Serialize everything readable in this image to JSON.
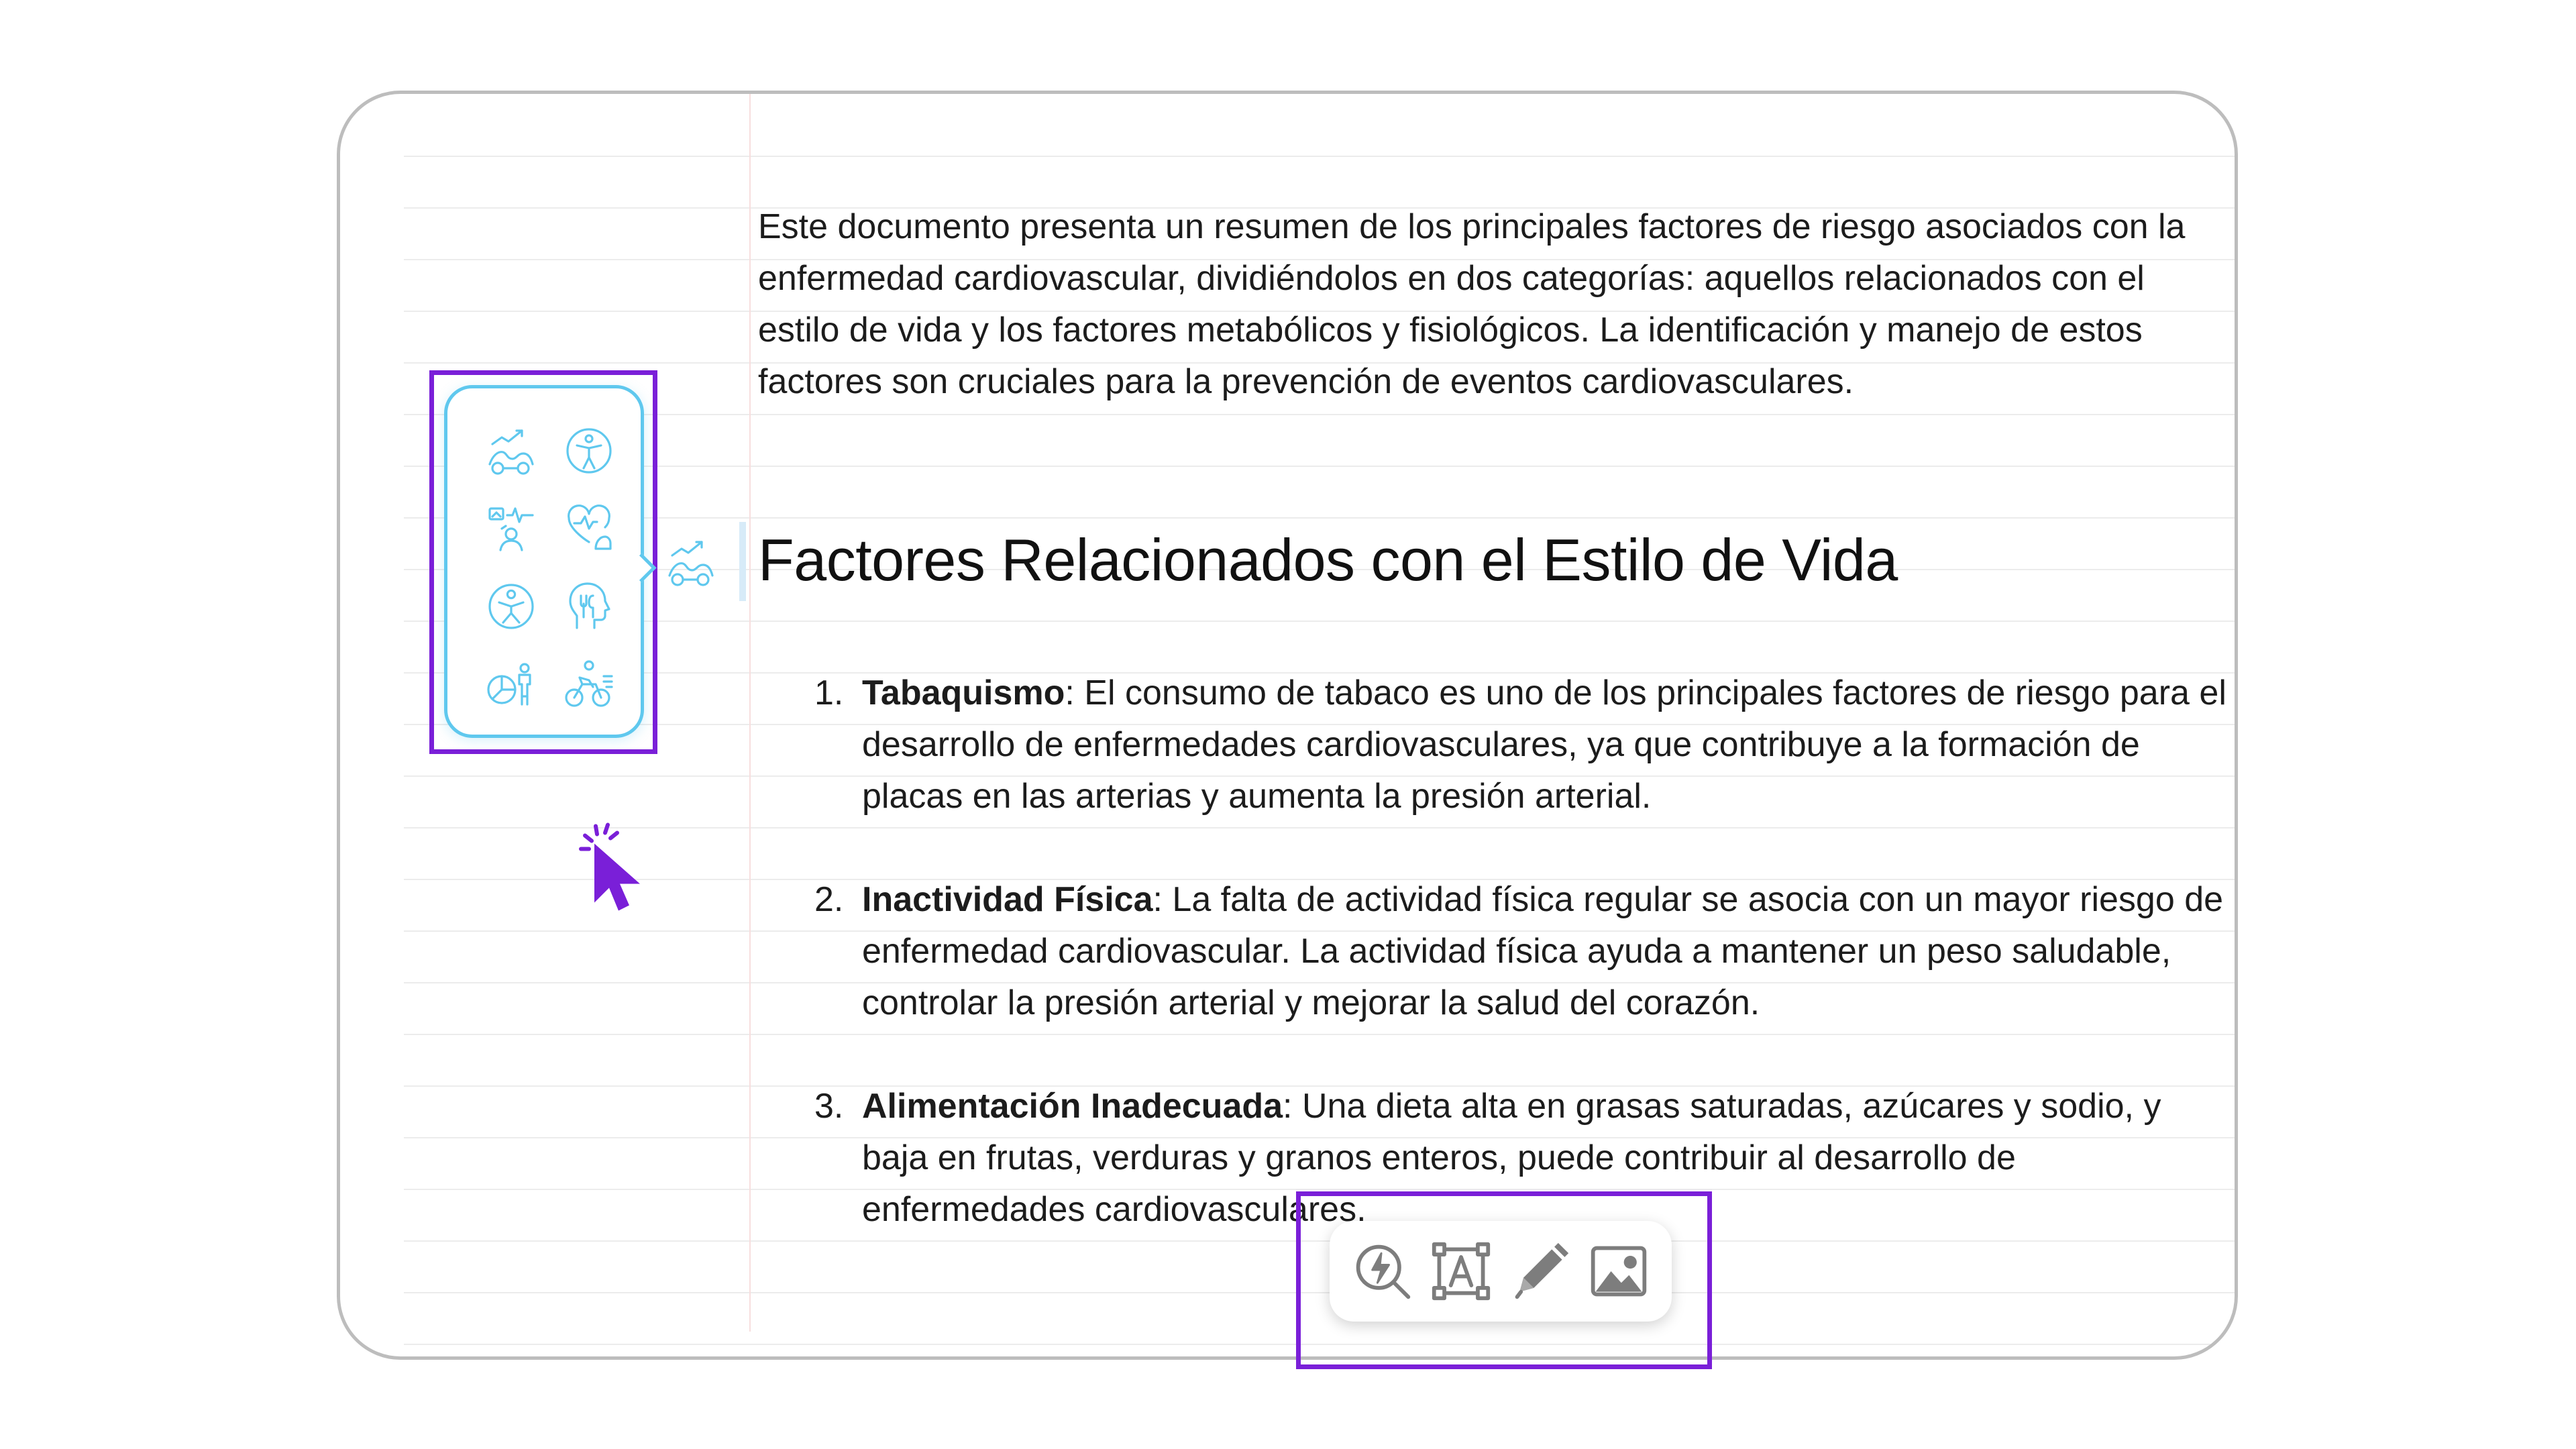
{
  "colors": {
    "highlight": "#7a1fd8",
    "icon_accent": "#5fc8ee",
    "cursor": "#7a1fd8",
    "toolbar_icon": "#7d7d7d"
  },
  "document": {
    "intro": "Este documento presenta un resumen de los principales factores de riesgo asociados con la enfermedad cardiovascular, dividiéndolos en dos categorías: aquellos relacionados con el estilo de vida y los factores metabólicos y fisiológicos. La identificación y manejo de estos factores son cruciales para la prevención de eventos cardiovasculares.",
    "heading": "Factores Relacionados con el Estilo de Vida",
    "items": [
      {
        "num": "1.",
        "term": "Tabaquismo",
        "text": ": El consumo de tabaco es uno de los principales factores de riesgo para el desarrollo de enfermedades cardiovasculares, ya que contribuye a la formación de placas en las arterias y aumenta la presión arterial."
      },
      {
        "num": "2.",
        "term": "Inactividad Física",
        "text": ": La falta de actividad física regular se asocia con un mayor riesgo de enfermedad cardiovascular. La actividad física ayuda a mantener un peso saludable, controlar la presión arterial y mejorar la salud del corazón."
      },
      {
        "num": "3.",
        "term": "Alimentación Inadecuada",
        "text": ": Una dieta alta en grasas saturadas, azúcares y sodio, y baja en frutas, verduras y granos enteros, puede contribuir al desarrollo de enfermedades cardiovasculares."
      }
    ]
  },
  "icon_picker": {
    "icons": [
      "weight-trend-icon",
      "accessibility-person-icon",
      "health-monitor-person-icon",
      "heart-strength-icon",
      "person-circle-icon",
      "head-nutrition-icon",
      "chart-person-icon",
      "cyclist-icon"
    ],
    "selected_icon": "weight-trend-icon"
  },
  "toolbar": {
    "buttons": [
      "quick-search-icon",
      "text-box-icon",
      "pencil-icon",
      "image-icon"
    ]
  }
}
